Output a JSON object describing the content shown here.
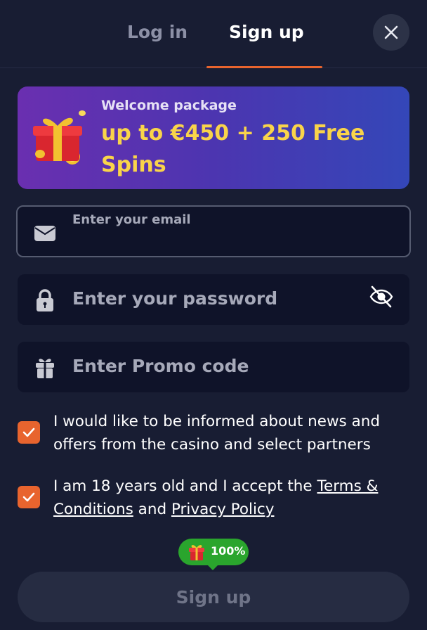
{
  "tabs": {
    "login": "Log in",
    "signup": "Sign up"
  },
  "banner": {
    "title": "Welcome package",
    "amount": "up to €450 + 250 Free Spins"
  },
  "form": {
    "email_label": "Enter your email",
    "password_placeholder": "Enter your password",
    "promo_placeholder": "Enter Promo code"
  },
  "consents": {
    "news_text": "I would like to be informed about news and offers from the casino and select partners",
    "age_prefix": "I am 18 years old and I accept the",
    "terms_link": "Terms & Conditions",
    "and_word": "and",
    "privacy_link": "Privacy Policy"
  },
  "badge": {
    "percent": "100%"
  },
  "submit_label": "Sign up",
  "colors": {
    "accent": "#e8642e",
    "badge": "#2aa52d",
    "banner_amount": "#f9d44a"
  },
  "icons": {
    "close": "close-icon",
    "gift": "gift-icon",
    "email": "envelope-icon",
    "password": "lock-icon",
    "visibility": "eye-off-icon",
    "promo": "gift-icon"
  }
}
